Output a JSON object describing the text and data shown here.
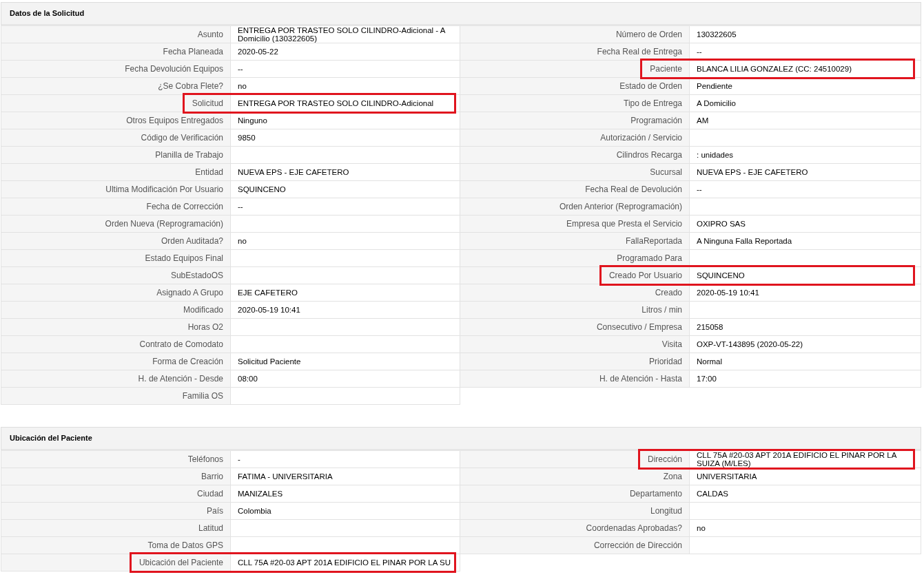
{
  "sections": [
    {
      "title": "Datos de la Solicitud",
      "left": [
        {
          "label": "Asunto",
          "value": "ENTREGA POR TRASTEO SOLO CILINDRO-Adicional - A Domicilio (130322605)",
          "highlighted": false
        },
        {
          "label": "Fecha Planeada",
          "value": "2020-05-22",
          "highlighted": false
        },
        {
          "label": "Fecha Devolución Equipos",
          "value": "--",
          "highlighted": false
        },
        {
          "label": "¿Se Cobra Flete?",
          "value": "no",
          "highlighted": false
        },
        {
          "label": "Solicitud",
          "value": "ENTREGA POR TRASTEO SOLO CILINDRO-Adicional",
          "highlighted": true
        },
        {
          "label": "Otros Equipos Entregados",
          "value": "Ninguno",
          "highlighted": false
        },
        {
          "label": "Código de Verificación",
          "value": "9850",
          "highlighted": false
        },
        {
          "label": "Planilla de Trabajo",
          "highlighted": false
        },
        {
          "label": "Entidad",
          "value": "NUEVA EPS - EJE CAFETERO",
          "highlighted": false
        },
        {
          "label": "Ultima Modificación Por Usuario",
          "value": "SQUINCENO",
          "highlighted": false
        },
        {
          "label": "Fecha de Corrección",
          "value": "--",
          "highlighted": false
        },
        {
          "label": "Orden Nueva (Reprogramación)",
          "highlighted": false
        },
        {
          "label": "Orden Auditada?",
          "value": "no",
          "highlighted": false
        },
        {
          "label": "Estado Equipos Final",
          "highlighted": false
        },
        {
          "label": "SubEstadoOS",
          "highlighted": false
        },
        {
          "label": "Asignado A Grupo",
          "value": "EJE CAFETERO",
          "highlighted": false
        },
        {
          "label": "Modificado",
          "value": "2020-05-19 10:41",
          "highlighted": false
        },
        {
          "label": "Horas O2",
          "highlighted": false
        },
        {
          "label": "Contrato de Comodato",
          "highlighted": false
        },
        {
          "label": "Forma de Creación",
          "value": "Solicitud Paciente",
          "highlighted": false
        },
        {
          "label": "H. de Atención - Desde",
          "value": "08:00",
          "highlighted": false
        },
        {
          "label": "Familia OS",
          "highlighted": false
        }
      ],
      "right": [
        {
          "label": "Número de Orden",
          "value": "130322605",
          "highlighted": false
        },
        {
          "label": "Fecha Real de Entrega",
          "value": "--",
          "highlighted": false
        },
        {
          "label": "Paciente",
          "value": "BLANCA LILIA GONZALEZ (CC: 24510029)",
          "highlighted": true
        },
        {
          "label": "Estado de Orden",
          "value": "Pendiente",
          "highlighted": false
        },
        {
          "label": "Tipo de Entrega",
          "value": "A Domicilio",
          "highlighted": false
        },
        {
          "label": "Programación",
          "value": "AM",
          "highlighted": false
        },
        {
          "label": "Autorización / Servicio",
          "highlighted": false
        },
        {
          "label": "Cilindros Recarga",
          "value": ": unidades",
          "highlighted": false
        },
        {
          "label": "Sucursal",
          "value": "NUEVA EPS - EJE CAFETERO",
          "highlighted": false
        },
        {
          "label": "Fecha Real de Devolución",
          "value": "--",
          "highlighted": false
        },
        {
          "label": "Orden Anterior (Reprogramación)",
          "highlighted": false
        },
        {
          "label": "Empresa que Presta el Servicio",
          "value": "OXIPRO SAS",
          "highlighted": false
        },
        {
          "label": "FallaReportada",
          "value": "A Ninguna Falla Reportada",
          "highlighted": false
        },
        {
          "label": "Programado Para",
          "highlighted": false
        },
        {
          "label": "Creado Por Usuario",
          "value": "SQUINCENO",
          "highlighted": true
        },
        {
          "label": "Creado",
          "value": "2020-05-19 10:41",
          "highlighted": false
        },
        {
          "label": "Litros / min",
          "highlighted": false
        },
        {
          "label": "Consecutivo / Empresa",
          "value": "215058",
          "highlighted": false
        },
        {
          "label": "Visita",
          "value": "OXP-VT-143895 (2020-05-22)",
          "highlighted": false
        },
        {
          "label": "Prioridad",
          "value": "Normal",
          "highlighted": false
        },
        {
          "label": "H. de Atención - Hasta",
          "value": "17:00",
          "highlighted": false
        }
      ]
    },
    {
      "title": "Ubicación del Paciente",
      "left": [
        {
          "label": "Teléfonos",
          "value": "-",
          "highlighted": false
        },
        {
          "label": "Barrio",
          "value": "FATIMA - UNIVERSITARIA",
          "highlighted": false
        },
        {
          "label": "Ciudad",
          "value": "MANIZALES",
          "highlighted": false
        },
        {
          "label": "País",
          "value": "Colombia",
          "highlighted": false
        },
        {
          "label": "Latitud",
          "highlighted": false
        },
        {
          "label": "Toma de Datos GPS",
          "highlighted": false
        },
        {
          "label": "Ubicación del Paciente",
          "value": "CLL 75A #20-03 APT 201A EDIFICIO EL PINAR POR LA SU",
          "highlighted": true
        }
      ],
      "right": [
        {
          "label": "Dirección",
          "value": "CLL 75A #20-03 APT 201A EDIFICIO EL PINAR POR LA SUIZA (M/LES)",
          "highlighted": true
        },
        {
          "label": "Zona",
          "value": "UNIVERSITARIA",
          "highlighted": false
        },
        {
          "label": "Departamento",
          "value": "CALDAS",
          "highlighted": false
        },
        {
          "label": "Longitud",
          "highlighted": false
        },
        {
          "label": "Coordenadas Aprobadas?",
          "value": "no",
          "highlighted": false
        },
        {
          "label": "Corrección de Dirección",
          "highlighted": false
        }
      ]
    }
  ]
}
